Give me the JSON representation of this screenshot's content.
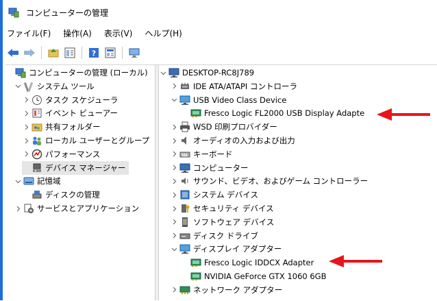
{
  "window": {
    "title": "コンピューターの管理"
  },
  "menu": [
    "ファイル(F)",
    "操作(A)",
    "表示(V)",
    "ヘルプ(H)"
  ],
  "toolbar": {
    "buttons": [
      "back-arrow-icon",
      "forward-arrow-icon",
      "up-folder-icon",
      "show-hide-tree-icon",
      "help-icon",
      "properties-icon",
      "monitor-icon"
    ]
  },
  "left_tree": [
    {
      "label": "コンピューターの管理 (ローカル)",
      "icon": "computer-management-icon",
      "level": 0,
      "exp": ""
    },
    {
      "label": "システム ツール",
      "icon": "system-tools-icon",
      "level": 1,
      "exp": "v"
    },
    {
      "label": "タスク スケジューラ",
      "icon": "clock-icon",
      "level": 2,
      "exp": ">"
    },
    {
      "label": "イベント ビューアー",
      "icon": "event-viewer-icon",
      "level": 2,
      "exp": ">"
    },
    {
      "label": "共有フォルダー",
      "icon": "shared-folder-icon",
      "level": 2,
      "exp": ">"
    },
    {
      "label": "ローカル ユーザーとグループ",
      "icon": "users-icon",
      "level": 2,
      "exp": ">"
    },
    {
      "label": "パフォーマンス",
      "icon": "performance-icon",
      "level": 2,
      "exp": ">"
    },
    {
      "label": "デバイス マネージャー",
      "icon": "device-manager-icon",
      "level": 2,
      "exp": "",
      "selected": true
    },
    {
      "label": "記憶域",
      "icon": "storage-icon",
      "level": 1,
      "exp": "v"
    },
    {
      "label": "ディスクの管理",
      "icon": "disk-management-icon",
      "level": 2,
      "exp": ""
    },
    {
      "label": "サービスとアプリケーション",
      "icon": "services-icon",
      "level": 1,
      "exp": ">"
    }
  ],
  "right_tree": [
    {
      "label": "DESKTOP-RC8J789",
      "icon": "computer-icon",
      "level": 0,
      "exp": "v"
    },
    {
      "label": "IDE ATA/ATAPI コントローラ",
      "icon": "ide-controller-icon",
      "level": 1,
      "exp": ">"
    },
    {
      "label": "USB Video Class Device",
      "icon": "monitor-icon",
      "level": 1,
      "exp": "v"
    },
    {
      "label": "Fresco Logic FL2000 USB Display Adapte",
      "icon": "display-adapter-icon",
      "level": 2,
      "exp": ""
    },
    {
      "label": "WSD 印刷プロバイダー",
      "icon": "printer-icon",
      "level": 1,
      "exp": ">"
    },
    {
      "label": "オーディオの入力および出力",
      "icon": "speaker-icon",
      "level": 1,
      "exp": ">"
    },
    {
      "label": "キーボード",
      "icon": "keyboard-icon",
      "level": 1,
      "exp": ">"
    },
    {
      "label": "コンピューター",
      "icon": "computer-icon",
      "level": 1,
      "exp": ">"
    },
    {
      "label": "サウンド、ビデオ、およびゲーム コントローラー",
      "icon": "sound-icon",
      "level": 1,
      "exp": ">"
    },
    {
      "label": "システム デバイス",
      "icon": "system-device-icon",
      "level": 1,
      "exp": ">"
    },
    {
      "label": "セキュリティ デバイス",
      "icon": "security-device-icon",
      "level": 1,
      "exp": ">"
    },
    {
      "label": "ソフトウェア デバイス",
      "icon": "software-device-icon",
      "level": 1,
      "exp": ">"
    },
    {
      "label": "ディスク ドライブ",
      "icon": "disk-drive-icon",
      "level": 1,
      "exp": ">"
    },
    {
      "label": "ディスプレイ アダプター",
      "icon": "monitor-icon",
      "level": 1,
      "exp": "v"
    },
    {
      "label": "Fresco Logic IDDCX Adapter",
      "icon": "display-adapter-icon",
      "level": 2,
      "exp": ""
    },
    {
      "label": "NVIDIA GeForce GTX 1060 6GB",
      "icon": "display-adapter-icon",
      "level": 2,
      "exp": ""
    },
    {
      "label": "ネットワーク アダプター",
      "icon": "network-adapter-icon",
      "level": 1,
      "exp": ">"
    },
    {
      "label": "",
      "icon": "partial-row-icon",
      "level": 1,
      "exp": ">"
    }
  ],
  "annotations": {
    "arrow_color": "#e8141b"
  },
  "colors": {
    "accent": "#1e6fd9",
    "selection": "#e5e5e5"
  }
}
